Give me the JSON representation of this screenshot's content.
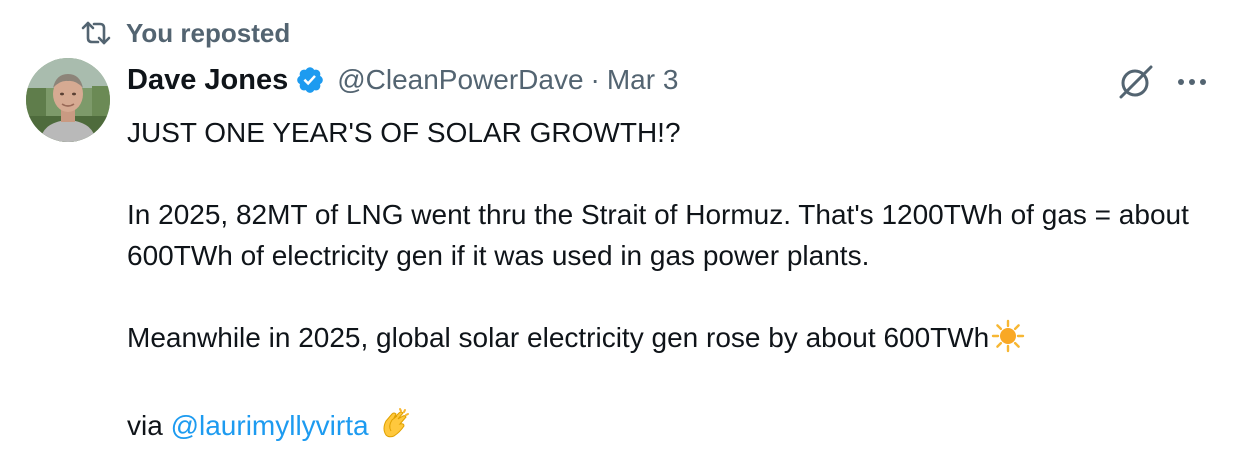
{
  "repost": {
    "label": "You reposted",
    "icon": "repost-icon"
  },
  "author": {
    "name": "Dave Jones",
    "handle": "@CleanPowerDave",
    "separator": "·",
    "date": "Mar 3",
    "verified": true
  },
  "actions": {
    "grok_icon": "grok-icon",
    "more_icon": "more-icon"
  },
  "content": {
    "line1": "JUST ONE YEAR'S OF SOLAR GROWTH!?",
    "para2": "In 2025, 82MT of LNG went thru the Strait of Hormuz. That's 1200TWh of gas = about 600TWh of electricity gen if it was used in gas power plants.",
    "para3": "Meanwhile in 2025, global solar electricity gen rose by about 600TWh",
    "para3_emoji": "sun-emoji",
    "para4_prefix": "via ",
    "para4_mention": "@laurimyllyvirta",
    "para4_emoji": "clapping-hands-emoji"
  },
  "colors": {
    "text": "#0f1419",
    "secondary": "#536471",
    "link": "#1d9bf0",
    "verified_badge": "#1d9bf0"
  }
}
